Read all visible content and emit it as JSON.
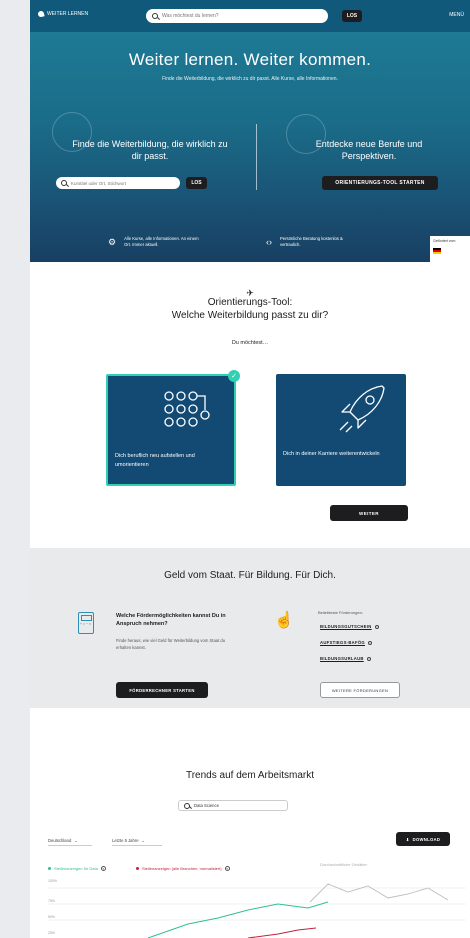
{
  "header": {
    "logo_text": "WEITER LERNEN",
    "search_placeholder": "Was möchtest du lernen?",
    "go_label": "LOS",
    "menu_label": "MENÜ"
  },
  "hero": {
    "title": "Weiter lernen. Weiter kommen.",
    "subtitle": "Finde die Weiterbildung, die wirklich zu dir passt. Alle Kurse, alle Informationen.",
    "left_title": "Finde die Weiterbildung, die wirklich zu dir passt.",
    "search_placeholder": "Kurstitel oder Ort, Stichwort",
    "go_label": "LOS",
    "right_title": "Entdecke neue Berufe und Perspektiven.",
    "tool_button": "ORIENTIERUNGS-TOOL STARTEN",
    "feature_1": "Alle Kurse, alle Informationen. An einem Ort. Immer aktuell.",
    "feature_2": "Persönliche Beratung kostenlos & vertraulich.",
    "badge_title": "Gefördert vom"
  },
  "orientation": {
    "icon": "paper-plane-icon",
    "title_line_1": "Orientierungs-Tool:",
    "title_line_2": "Welche Weiterbildung passt zu dir?",
    "question": "Du möchtest…",
    "card_1_label": "Dich beruflich neu aufstellen und umorientieren",
    "card_2_label": "Dich in deiner Karriere weiterentwickeln",
    "next_button": "WEITER"
  },
  "funding": {
    "title": "Geld vom Staat. Für Bildung. Für Dich.",
    "question": "Welche Fördermöglichkeiten kannst Du in Anspruch nehmen?",
    "text": "Finde heraus, wie viel Geld für Weiterbildung vom Staat du erhalten kannst.",
    "calc_button": "FÖRDERRECHNER STARTEN",
    "list_head": "Beliebteste Förderungen:",
    "links": [
      "BILDUNGSGUTSCHEIN",
      "AUFSTIEGS-BAFÖG",
      "BILDUNGSURLAUB"
    ],
    "more_button": "WEITERE FÖRDERUNGEN"
  },
  "trends": {
    "title": "Trends auf dem Arbeitsmarkt",
    "search_value": "Data Science",
    "region": "Deutschland",
    "period": "Letzte 5 Jahre",
    "download": "DOWNLOAD",
    "legend_1": "Stellenanzeigen für Data",
    "legend_2": "Stellenanzeigen (alle Branchen, normalisiert)",
    "legend_3": "Durchschnittliche Gehälter"
  },
  "colors": {
    "nav": "#10597a",
    "accent_teal": "#2fd0b4",
    "card_blue": "#124a74",
    "link_blue": "#2b8fb8",
    "series_1": "#2fbf98",
    "series_2": "#c2213d",
    "series_3": "#bdbdbd"
  }
}
